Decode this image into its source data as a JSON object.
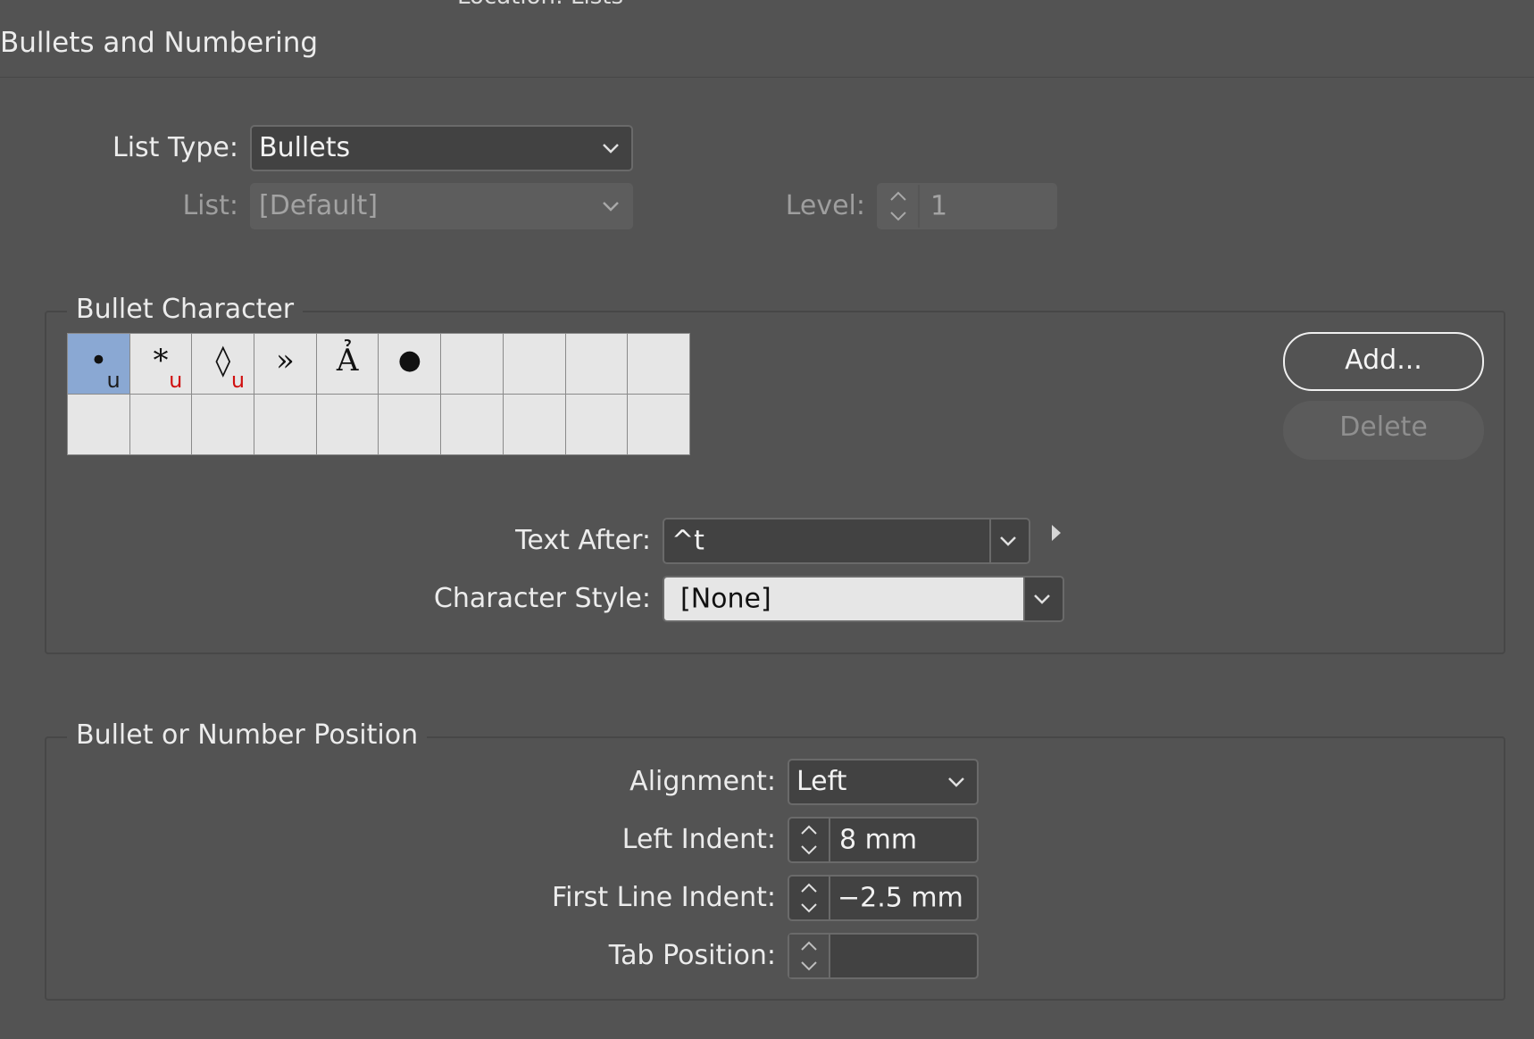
{
  "header": {
    "location_text": "Location: Lists",
    "title": "Bullets and Numbering"
  },
  "list_type": {
    "label": "List Type:",
    "value": "Bullets"
  },
  "list": {
    "label": "List:",
    "value": "[Default]"
  },
  "level": {
    "label": "Level:",
    "value": "1"
  },
  "bullet_character": {
    "title": "Bullet Character",
    "glyphs": [
      {
        "char": "•",
        "font_mark": "u"
      },
      {
        "char": "*",
        "font_mark": "u"
      },
      {
        "char": "◊",
        "font_mark": "u"
      },
      {
        "char": "»",
        "font_mark": ""
      },
      {
        "char": "Ả",
        "font_mark": ""
      },
      {
        "char": "●",
        "font_mark": ""
      }
    ],
    "add_label": "Add...",
    "delete_label": "Delete",
    "text_after": {
      "label": "Text After:",
      "value": "^t"
    },
    "character_style": {
      "label": "Character Style:",
      "value": "[None]"
    }
  },
  "position": {
    "title": "Bullet or Number Position",
    "alignment": {
      "label": "Alignment:",
      "value": "Left"
    },
    "left_indent": {
      "label": "Left Indent:",
      "value": "8 mm"
    },
    "first_line_indent": {
      "label": "First Line Indent:",
      "value": "−2.5 mm"
    },
    "tab_position": {
      "label": "Tab Position:",
      "value": ""
    }
  },
  "colors": {
    "background": "#535353",
    "selected_cell": "#8aa8d3",
    "font_marker": "#d01010"
  }
}
